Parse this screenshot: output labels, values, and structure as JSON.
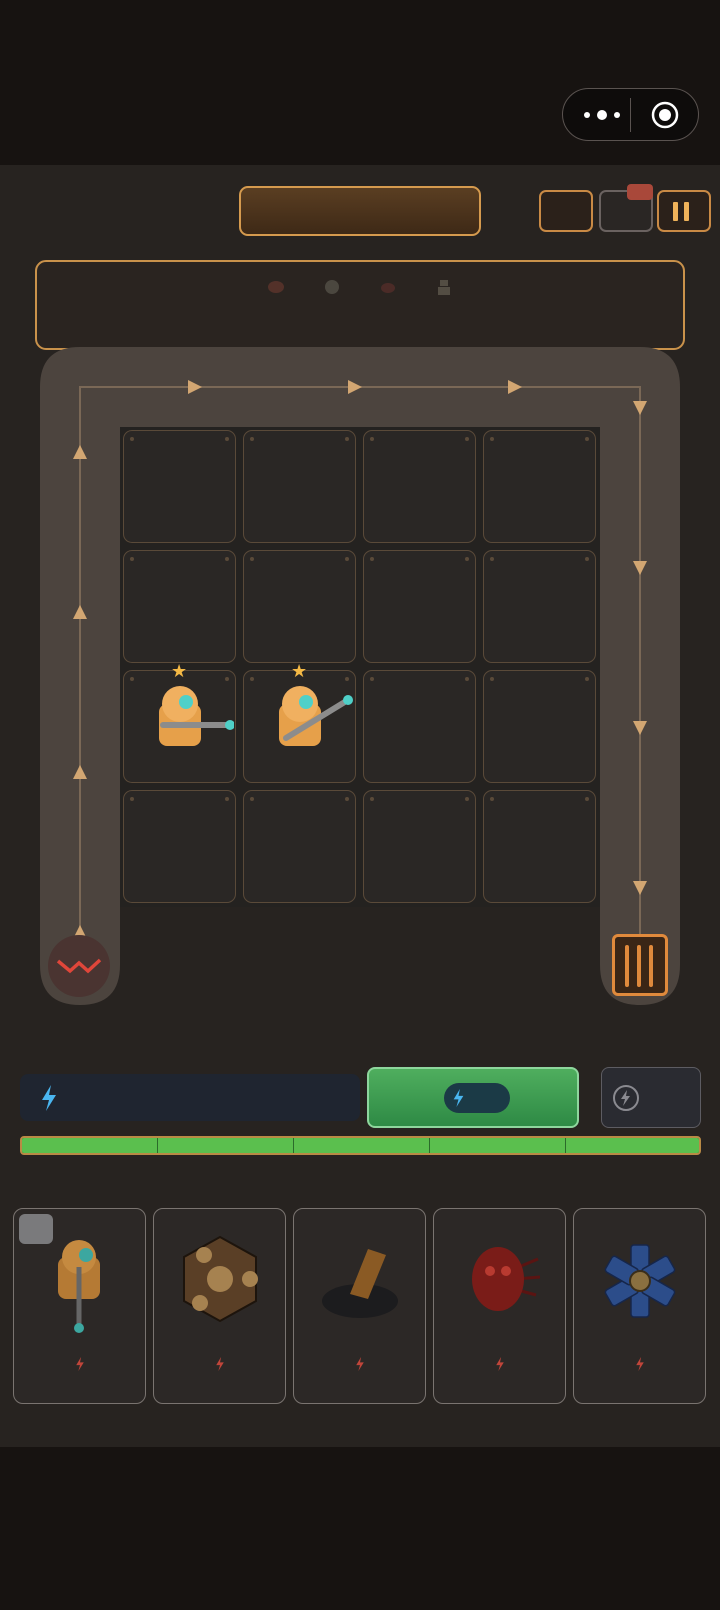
{
  "top_capsule": {
    "menu_icon": "more-dots-icon",
    "close_icon": "target-circle-icon"
  },
  "header": {
    "title_bar": "",
    "buttons": [
      "speed-button",
      "shop-button",
      "pause-button"
    ]
  },
  "wave_preview": {
    "enemy_icons": [
      "beetle-icon",
      "orb-icon",
      "bug-icon",
      "robot-icon"
    ]
  },
  "board": {
    "rows": 4,
    "cols": 4,
    "units": [
      {
        "row": 2,
        "col": 0,
        "type": "orange-rifle-robot",
        "stars": "★"
      },
      {
        "row": 2,
        "col": 1,
        "type": "orange-rifle-robot",
        "stars": "★"
      }
    ]
  },
  "energy": {
    "value_text": "",
    "progress": 1.0,
    "segments": 5
  },
  "cards": [
    {
      "name": "robot-gunner-card",
      "locked": true,
      "cost": ""
    },
    {
      "name": "hex-mine-card",
      "locked": false,
      "cost": ""
    },
    {
      "name": "cannon-card",
      "locked": false,
      "cost": ""
    },
    {
      "name": "red-beetle-card",
      "locked": false,
      "cost": ""
    },
    {
      "name": "blue-gear-card",
      "locked": false,
      "cost": ""
    }
  ],
  "colors": {
    "accent": "#d59a4e",
    "progress": "#5bbf4e",
    "upgrade": "#3d9c52",
    "cost_bolt": "#c0453a",
    "energy_bolt": "#4ab6f0"
  }
}
